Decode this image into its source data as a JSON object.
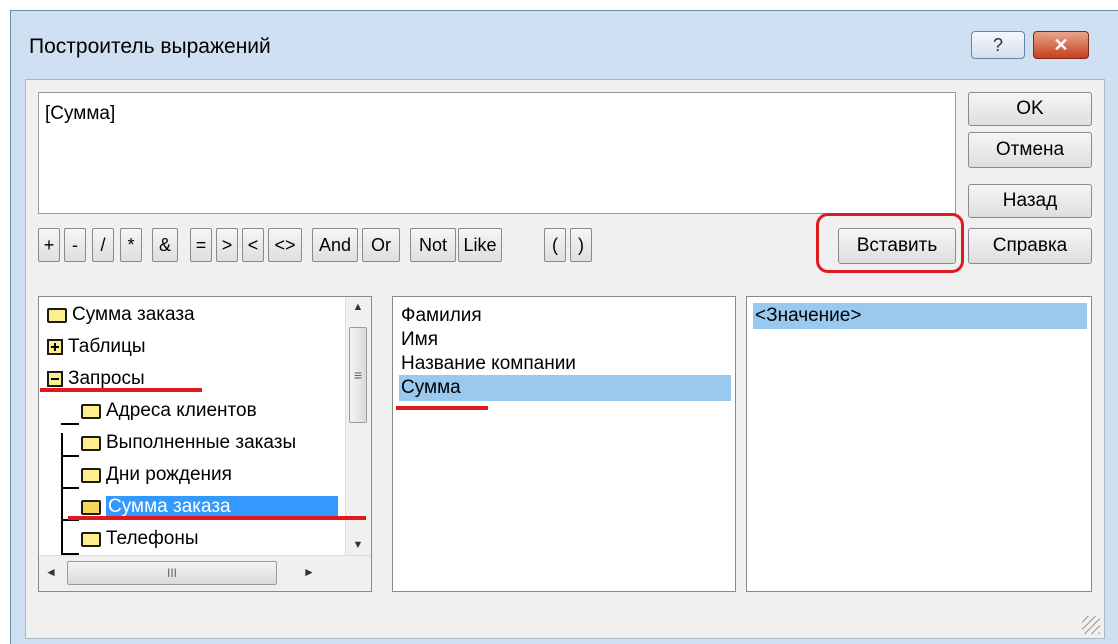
{
  "window": {
    "title": "Построитель выражений",
    "help_symbol": "?",
    "close_symbol": "✕"
  },
  "expression": {
    "value": "[Сумма]"
  },
  "buttons": {
    "ok": "OK",
    "cancel": "Отмена",
    "back": "Назад",
    "insert": "Вставить",
    "help": "Справка"
  },
  "operators": [
    "+",
    "-",
    "/",
    "*",
    "&",
    "=",
    ">",
    "<",
    "<>",
    "And",
    "Or",
    "Not",
    "Like",
    "(",
    ")"
  ],
  "tree": {
    "items": [
      {
        "label": "Сумма заказа"
      },
      {
        "label": "Таблицы"
      },
      {
        "label": "Запросы"
      },
      {
        "label": "Адреса клиентов"
      },
      {
        "label": "Выполненные заказы"
      },
      {
        "label": "Дни рождения"
      },
      {
        "label": "Сумма заказа"
      },
      {
        "label": "Телефоны"
      }
    ],
    "scroll_up": "▲",
    "scroll_down": "▼",
    "scroll_left": "◄",
    "scroll_right": "►",
    "grip": "≡",
    "hgrip": "III"
  },
  "fields": {
    "items": [
      "Фамилия",
      "Имя",
      "Название компании",
      "Сумма"
    ]
  },
  "values": {
    "items": [
      "<Значение>"
    ]
  },
  "colors": {
    "annotation_red": "#e0191f",
    "selection": "#99c9ef",
    "selection_active": "#3399ff"
  }
}
